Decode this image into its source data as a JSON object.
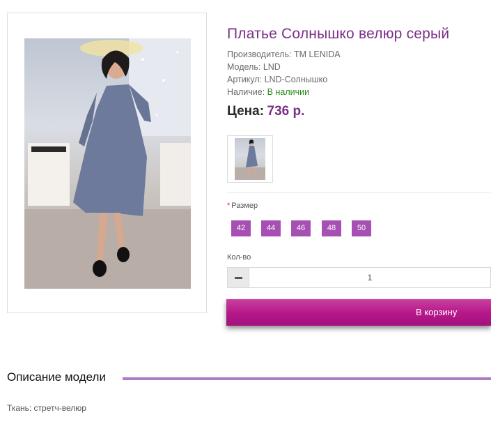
{
  "product": {
    "title": "Платье Солнышко велюр серый",
    "manufacturer_label": "Производитель:",
    "manufacturer_value": "TM LENIDA",
    "model_label": "Модель:",
    "model_value": "LND",
    "article_label": "Артикул:",
    "article_value": "LND-Солнышко",
    "availability_label": "Наличие:",
    "availability_value": "В наличии",
    "price_label": "Цена:",
    "price_value": "736 р."
  },
  "options": {
    "size_required_mark": "*",
    "size_label": "Размер",
    "sizes": [
      "42",
      "44",
      "46",
      "48",
      "50"
    ],
    "qty_label": "Кол-во",
    "qty_value": "1",
    "cart_button": "В корзину"
  },
  "description": {
    "title": "Описание модели",
    "text": "Ткань: стретч-велюр"
  },
  "colors": {
    "accent": "#7a2f86",
    "size_button": "#a750b3",
    "cart_button": "#b5168a",
    "in_stock": "#2c8a1f",
    "divider_line": "#b07bc0"
  },
  "icons": {
    "qty_decrement": "minus-icon"
  }
}
